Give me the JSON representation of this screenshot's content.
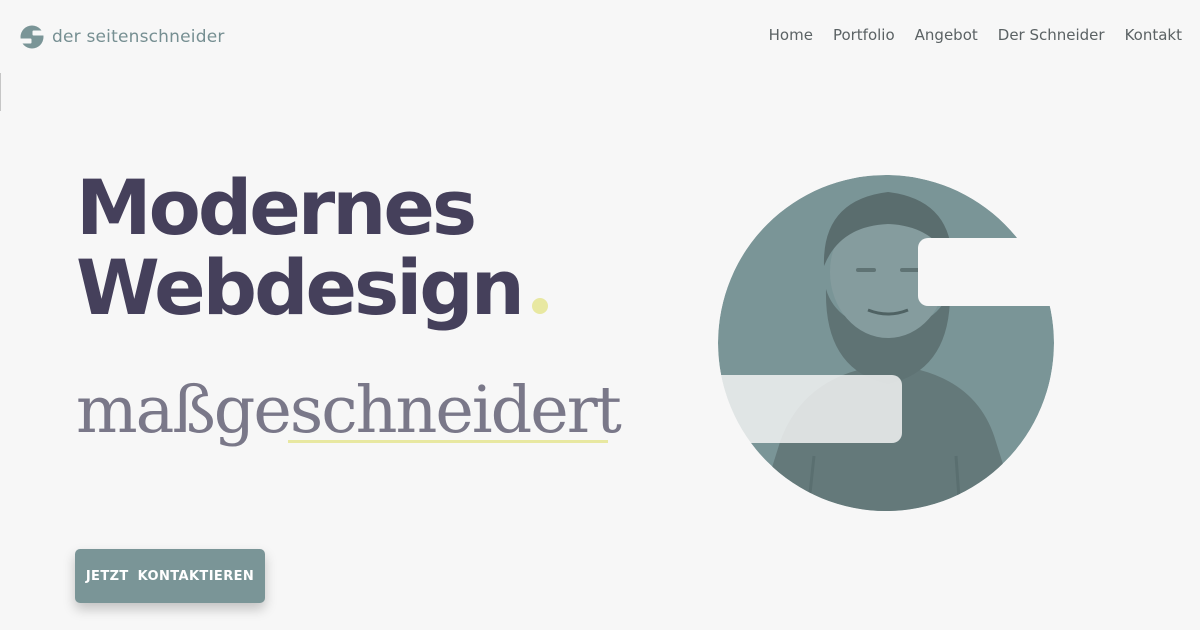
{
  "header": {
    "logo_text": "der seitenschneider"
  },
  "nav": {
    "items": [
      {
        "label": "Home"
      },
      {
        "label": "Portfolio"
      },
      {
        "label": "Angebot"
      },
      {
        "label": "Der Schneider"
      },
      {
        "label": "Kontakt"
      }
    ]
  },
  "hero": {
    "title_line1": "Modernes",
    "title_line2": "Webdesign",
    "subtitle": "maßgeschneidert",
    "cta_label": "JETZT KONTAKTIEREN"
  },
  "colors": {
    "brand_teal": "#7a9597",
    "title": "#45405b",
    "subtitle": "#7a7889",
    "accent_yellow": "#e8e8a1",
    "background": "#f7f7f7"
  },
  "icons": {
    "logo": "s-logo-icon"
  }
}
